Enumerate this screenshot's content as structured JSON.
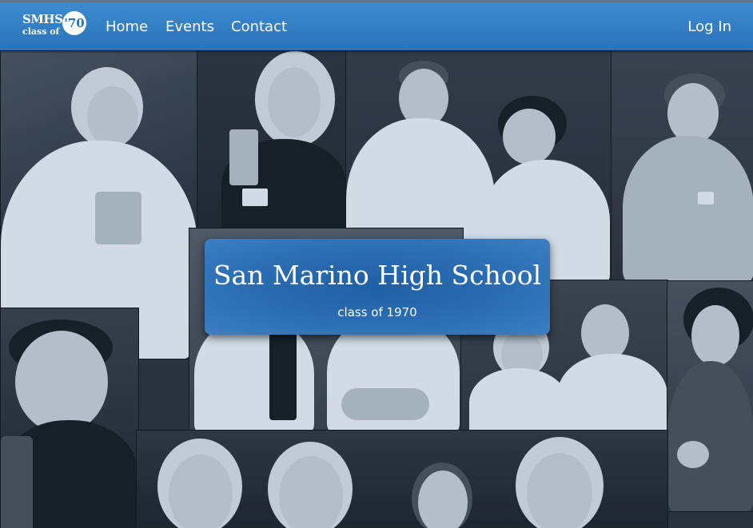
{
  "navbar": {
    "logo": {
      "line1": "SMHS",
      "line2": "class of",
      "year": "'70"
    },
    "links": {
      "home": "Home",
      "events": "Events",
      "contact": "Contact"
    },
    "login": "Log In"
  },
  "hero": {
    "title": "San Marino High School",
    "subtitle": "class of 1970"
  },
  "colors": {
    "navbar": "#2f7bc2",
    "card": "#2a6ab0",
    "text": "#ffffff"
  }
}
